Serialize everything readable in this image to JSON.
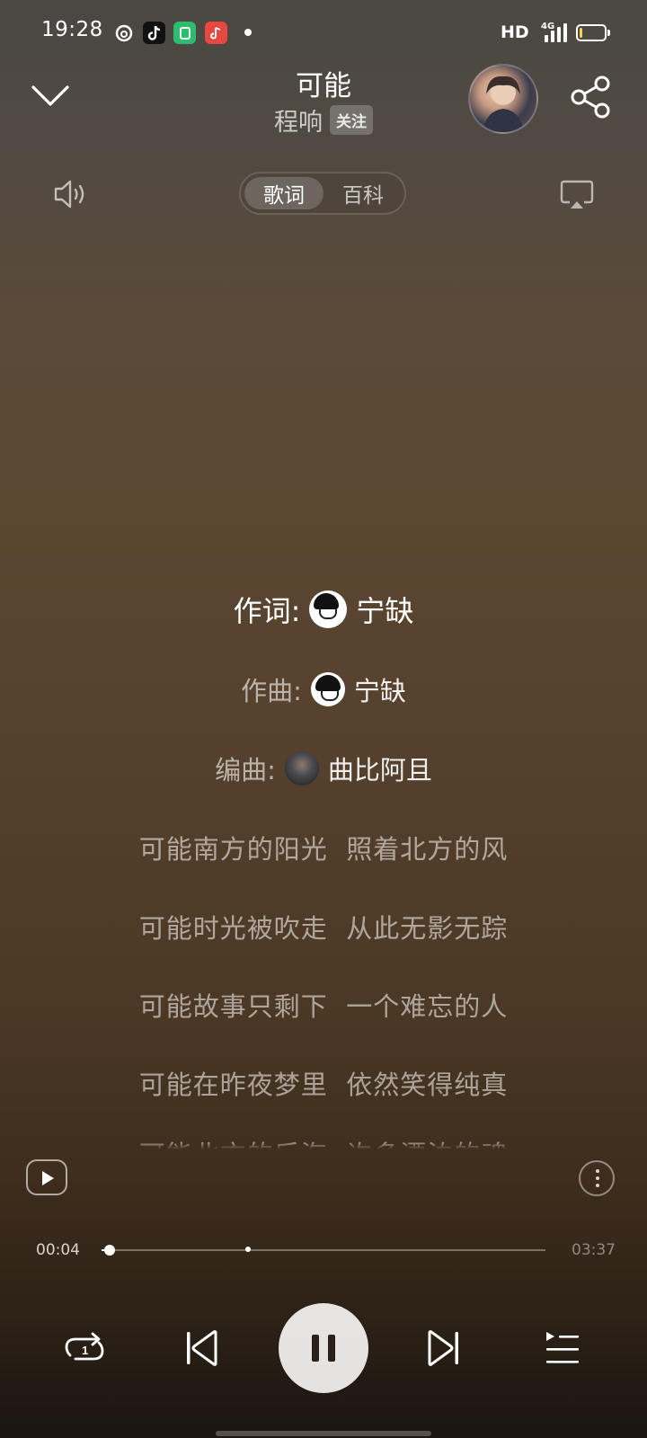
{
  "status_bar": {
    "time": "19:28",
    "network_label": "HD",
    "network_type": "4G",
    "app_icons": [
      "netease-music-icon",
      "tiktok-icon",
      "green-app-icon",
      "red-music-app-icon"
    ],
    "battery_level": 0.1
  },
  "header": {
    "song_title": "可能",
    "artist": "程响",
    "follow_label": "关注"
  },
  "tabs": {
    "lyrics_label": "歌词",
    "wiki_label": "百科",
    "active": "歌词"
  },
  "lyrics": {
    "credits": [
      {
        "label": "作词:",
        "name": "宁缺"
      },
      {
        "label": "作曲:",
        "name": "宁缺"
      },
      {
        "label": "编曲:",
        "name": "曲比阿且"
      }
    ],
    "lines": [
      "可能南方的阳光  照着北方的风",
      "可能时光被吹走  从此无影无踪",
      "可能故事只剩下  一个难忘的人",
      "可能在昨夜梦里  依然笑得纯真",
      "可能北方的后海  许多漂泊的魂"
    ]
  },
  "player": {
    "current_time": "00:04",
    "total_time": "03:37",
    "progress": 0.018,
    "highlight_marker": 0.329,
    "repeat_badge": "1",
    "state": "playing"
  },
  "colors": {
    "bg_top": "#4a4843",
    "bg_mid": "#5c4831",
    "bg_bottom": "#1b1510",
    "play_button": "#ffffff"
  }
}
